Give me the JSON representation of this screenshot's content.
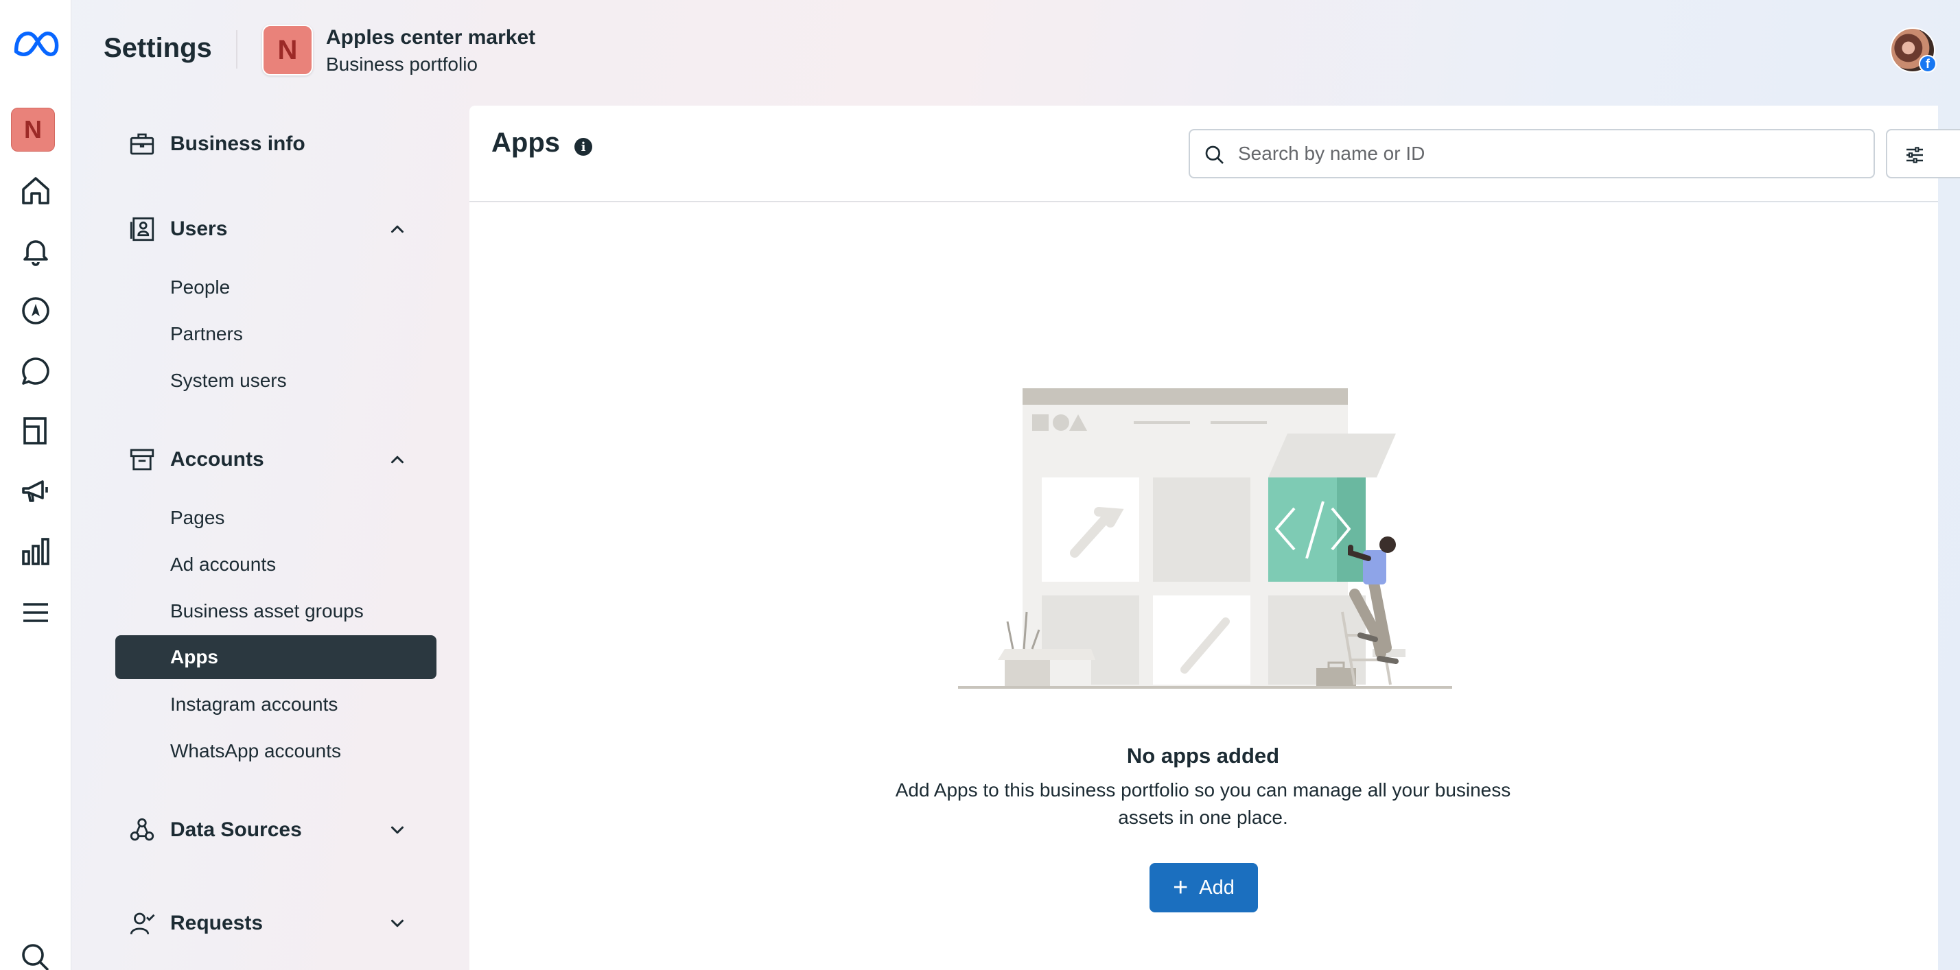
{
  "header": {
    "title": "Settings",
    "business": {
      "avatar_letter": "N",
      "name": "Apples center market",
      "subtitle": "Business portfolio"
    }
  },
  "rail": {
    "avatar_letter": "N",
    "icons": [
      "meta-logo-icon",
      "home-icon",
      "notifications-bell-icon",
      "compass-icon",
      "chat-bubble-icon",
      "pages-icon",
      "megaphone-icon",
      "bar-chart-icon",
      "menu-icon",
      "search-icon"
    ]
  },
  "sidebar": {
    "business_info": "Business info",
    "users": {
      "label": "Users",
      "items": [
        "People",
        "Partners",
        "System users"
      ]
    },
    "accounts": {
      "label": "Accounts",
      "items": [
        "Pages",
        "Ad accounts",
        "Business asset groups",
        "Apps",
        "Instagram accounts",
        "WhatsApp accounts"
      ],
      "active": "Apps"
    },
    "data_sources": "Data Sources",
    "requests": "Requests"
  },
  "main": {
    "title": "Apps",
    "search_placeholder": "Search by name or ID",
    "empty_title": "No apps added",
    "empty_desc": "Add Apps to this business portfolio so you can manage all your business assets in one place.",
    "add_label": "Add"
  },
  "colors": {
    "active_nav": "#2b3840",
    "primary_button": "#1b6fbf",
    "avatar_bg": "#e9827a",
    "illustration_accent": "#7ecbb4"
  }
}
